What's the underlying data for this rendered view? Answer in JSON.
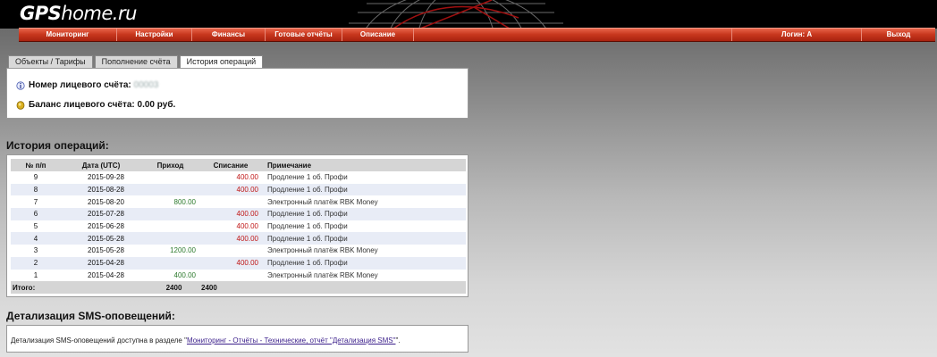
{
  "header": {
    "logo_bold": "GPS",
    "logo_rest": "home.ru"
  },
  "menu": {
    "items": [
      "Мониторинг",
      "Настройки",
      "Финансы",
      "Готовые отчёты",
      "Описание"
    ],
    "login_label": "Логин: A",
    "logout_label": "Выход"
  },
  "tabs": [
    {
      "label": "Объекты / Тарифы",
      "active": false
    },
    {
      "label": "Пополнение счёта",
      "active": false
    },
    {
      "label": "История операций",
      "active": true
    }
  ],
  "account": {
    "number_label": "Номер лицевого счёта:",
    "number_value": "00003",
    "balance_label": "Баланс лицевого счёта: 0.00 руб."
  },
  "history": {
    "title": "История операций:",
    "columns": [
      "№ п/п",
      "Дата (UTC)",
      "Приход",
      "Списание",
      "Примечание"
    ],
    "rows": [
      {
        "n": "9",
        "date": "2015-09-28",
        "income": "",
        "expense": "400.00",
        "note": "Продление 1 об. Профи"
      },
      {
        "n": "8",
        "date": "2015-08-28",
        "income": "",
        "expense": "400.00",
        "note": "Продление 1 об. Профи"
      },
      {
        "n": "7",
        "date": "2015-08-20",
        "income": "800.00",
        "expense": "",
        "note": "Электронный платёж RBK Money"
      },
      {
        "n": "6",
        "date": "2015-07-28",
        "income": "",
        "expense": "400.00",
        "note": "Продление 1 об. Профи"
      },
      {
        "n": "5",
        "date": "2015-06-28",
        "income": "",
        "expense": "400.00",
        "note": "Продление 1 об. Профи"
      },
      {
        "n": "4",
        "date": "2015-05-28",
        "income": "",
        "expense": "400.00",
        "note": "Продление 1 об. Профи"
      },
      {
        "n": "3",
        "date": "2015-05-28",
        "income": "1200.00",
        "expense": "",
        "note": "Электронный платёж RBK Money"
      },
      {
        "n": "2",
        "date": "2015-04-28",
        "income": "",
        "expense": "400.00",
        "note": "Продление 1 об. Профи"
      },
      {
        "n": "1",
        "date": "2015-04-28",
        "income": "400.00",
        "expense": "",
        "note": "Электронный платёж RBK Money"
      }
    ],
    "total_label": "Итого:",
    "total_income": "2400",
    "total_expense": "2400"
  },
  "sms": {
    "title": "Детализация SMS-оповещений:",
    "text_before": "Детализация SMS-оповещений доступна в разделе \"",
    "link_text": "Мониторинг - Отчёты - Технические, отчёт \"Детализация SMS\"",
    "text_after": "\"."
  },
  "colors": {
    "menu_red": "#c9381f",
    "income_green": "#2d7a2d",
    "expense_red": "#c01818",
    "row_alt": "#e8ecf6"
  }
}
